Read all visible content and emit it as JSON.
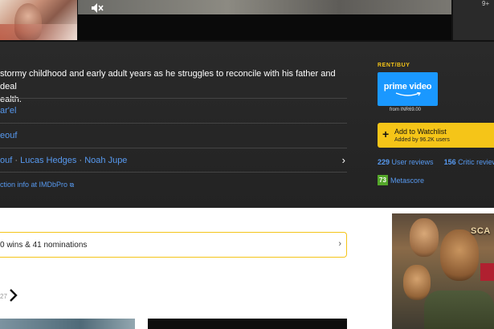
{
  "media": {
    "mute_icon": "volume-mute-icon",
    "side_text": "9+"
  },
  "hero": {
    "plot_line1": "stormy childhood and early adult years as he struggles to reconcile with his father and deal",
    "plot_line2": "ealth.",
    "credits": [
      {
        "label": "ar'el"
      },
      {
        "label": "eouf"
      }
    ],
    "stars": {
      "items": [
        "ouf",
        "Lucas Hedges",
        "Noah Jupe"
      ],
      "separator": "·"
    },
    "imdbpro_link": "ction info at IMDbPro",
    "rent_buy_label": "RENT/BUY",
    "prime_label": "prime video",
    "prime_from": "from INR69.00",
    "watchlist_title": "Add to Watchlist",
    "watchlist_sub": "Added by 96.2K users",
    "user_reviews_count": "229",
    "user_reviews_label": "User reviews",
    "critic_reviews_count": "156",
    "critic_reviews_label": "Critic reviews",
    "metascore_value": "73",
    "metascore_label": "Metascore"
  },
  "lower": {
    "awards_text": "0 wins & 41 nominations",
    "photos_count": "27",
    "ad_title": "SCA"
  },
  "colors": {
    "accent_yellow": "#f5c518",
    "link_blue": "#5799ef",
    "prime_blue": "#1a98ff",
    "metascore_green": "#54a72a"
  }
}
